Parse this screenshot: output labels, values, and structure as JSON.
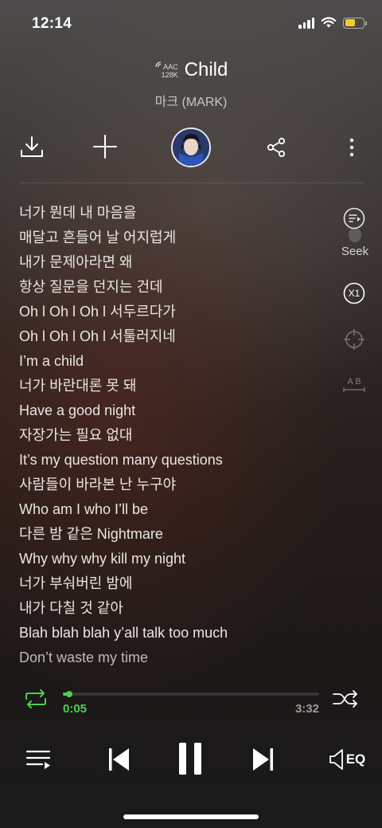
{
  "status": {
    "time": "12:14"
  },
  "header": {
    "quality_top": "AAC",
    "quality_bottom": "128K",
    "title": "Child",
    "artist": "마크 (MARK)"
  },
  "actions": {
    "download_icon": "download-icon",
    "add_icon": "plus-icon",
    "share_icon": "share-icon",
    "more_icon": "more-vertical-icon"
  },
  "lyrics": [
    "너가 뭔데 내 마음을",
    "매달고 흔들어 날 어지럽게",
    "내가 문제아라면 왜",
    "항상 질문을 던지는 건데",
    "Oh l Oh l Oh l 서두르다가",
    "Oh l Oh l Oh l 서툴러지네",
    "I’m a child",
    "너가 바란대론 못 돼",
    "Have a good night",
    "자장가는 필요 없대",
    "It’s my question many questions",
    "사람들이 바라본 난 누구야",
    "Who am I who I’ll be",
    "다른 밤 같은 Nightmare",
    "Why why why kill my night",
    "너가 부숴버린 밤에",
    "내가 다칠 것 같아",
    "Blah blah blah y’all talk too much",
    "Don’t waste my time"
  ],
  "side_tools": {
    "seek_label": "Seek",
    "speed_label": "X1",
    "ab_label": "A B"
  },
  "playback": {
    "elapsed": "0:05",
    "total": "3:32",
    "progress_fraction": 0.024,
    "accent_color": "#4bd04f"
  },
  "controls": {
    "eq_label": "EQ"
  }
}
